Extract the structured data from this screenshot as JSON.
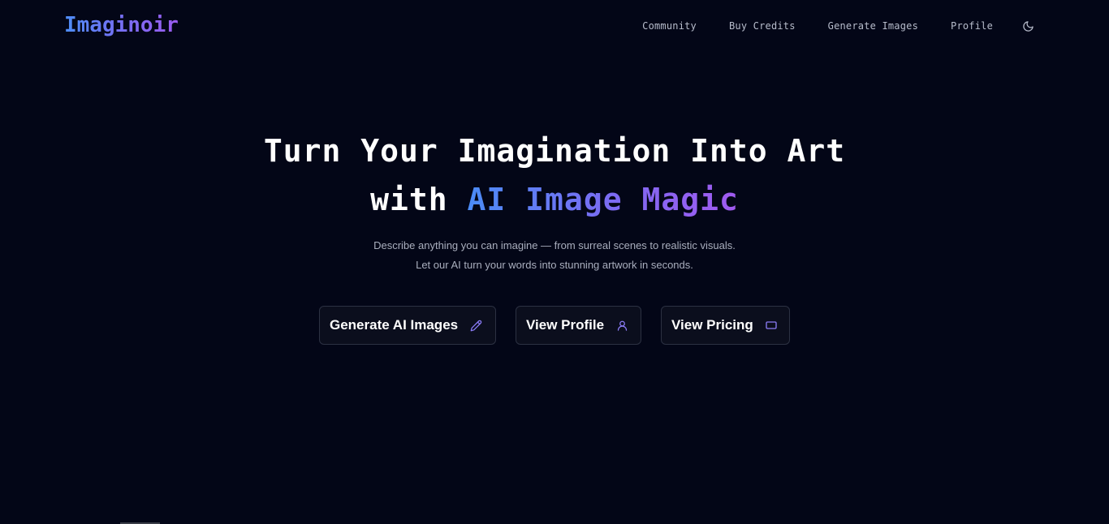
{
  "brand": {
    "name": "Imaginoir"
  },
  "nav": {
    "items": [
      {
        "label": "Community"
      },
      {
        "label": "Buy Credits"
      },
      {
        "label": "Generate Images"
      },
      {
        "label": "Profile"
      }
    ],
    "theme_toggle_icon": "moon-icon"
  },
  "hero": {
    "title_line1": "Turn Your Imagination Into Art",
    "title_line2_prefix": "with",
    "title_line2_highlight": "AI Image Magic",
    "subtitle_line1": "Describe anything you can imagine — from surreal scenes to realistic visuals.",
    "subtitle_line2": "Let our AI turn your words into stunning artwork in seconds."
  },
  "actions": {
    "generate": {
      "label": "Generate AI Images",
      "icon": "pencil-icon"
    },
    "profile": {
      "label": "View Profile",
      "icon": "user-icon"
    },
    "pricing": {
      "label": "View Pricing",
      "icon": "card-icon"
    }
  },
  "colors": {
    "background": "#030617",
    "accent_blue": "#4b8cf7",
    "accent_purple": "#a15af0",
    "icon_purple": "#8b7cf6"
  }
}
